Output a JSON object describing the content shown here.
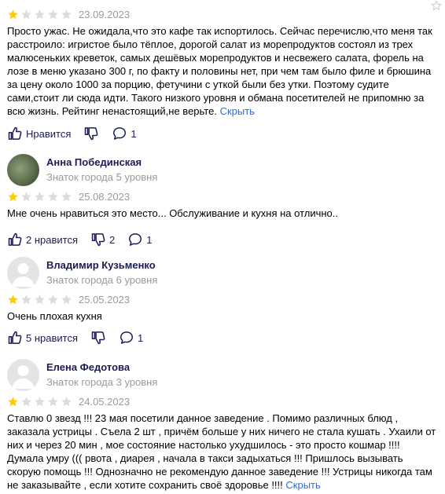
{
  "reviews": [
    {
      "rating": 1,
      "date": "23.09.2023",
      "text": "Просто ужас. Не ожидала,что это кафе так испортилось. Сейчас перечислю,что меня так расстроило: игристое было тёплое, дорогой салат из морепродуктов состоял из трех малюсеньких креветок, самых дешёвых морепродуктов и несвежего салата, форель на лозе в меню указано 300 г, по факту и половины нет, при чем там было филе и брюшина за цену около 1000 за порцию, фетучини с уткой были без утки. Поэтому судите сами,стоит ли сюда идти. Такого низкого уровня и обмана посетителей не припомню за всю жизнь. Рейтинг ненастоящий,не верьте.",
      "hide_label": "Скрыть",
      "likes_label": "Нравится",
      "comments": "1"
    },
    {
      "author": "Анна Побединская",
      "level": "Знаток города 5 уровня",
      "rating": 1,
      "date": "25.08.2023",
      "text": "Мне очень нравиться это место... Обслуживание и кухня на отлично..",
      "likes_label": "2 нравится",
      "dislikes": "2",
      "comments": "1"
    },
    {
      "author": "Владимир Кузьменко",
      "level": "Знаток города 6 уровня",
      "rating": 1,
      "date": "25.05.2023",
      "text": "Очень плохая кухня",
      "likes_label": "5 нравится",
      "comments": "1"
    },
    {
      "author": "Елена Федотова",
      "level": "Знаток города 3 уровня",
      "rating": 1,
      "date": "24.05.2023",
      "text": "Ставлю 0 звезд !!! 23 мая посетили данное заведение . Помимо различных блюд , заказала устрицы . Съела 2 шт , причём больше у них ничего не стала кушать . Ухаили от них и через 20 мин , мое состояние настолько ухудшилось - это просто кошмар !!!! Думала умру ((( рвота , диарея , начала в такси задыхаться !!! Пришлось вызывать скорую помощь !!! Однозначно не рекомендую данное заведение !!! Устрицы никогда там не заказывайте , если хотите сохранить своё здоровье !!!!",
      "hide_label": "Скрыть"
    }
  ],
  "colors": {
    "star_filled": "#fc0",
    "star_empty": "#dcdcdc",
    "author": "#1b1b55",
    "meta": "#9a9a9a",
    "link": "#2c6be0"
  },
  "icons": [
    "like-icon",
    "dislike-icon",
    "comment-icon",
    "star-icon",
    "bookmark-icon",
    "default-avatar-icon"
  ]
}
